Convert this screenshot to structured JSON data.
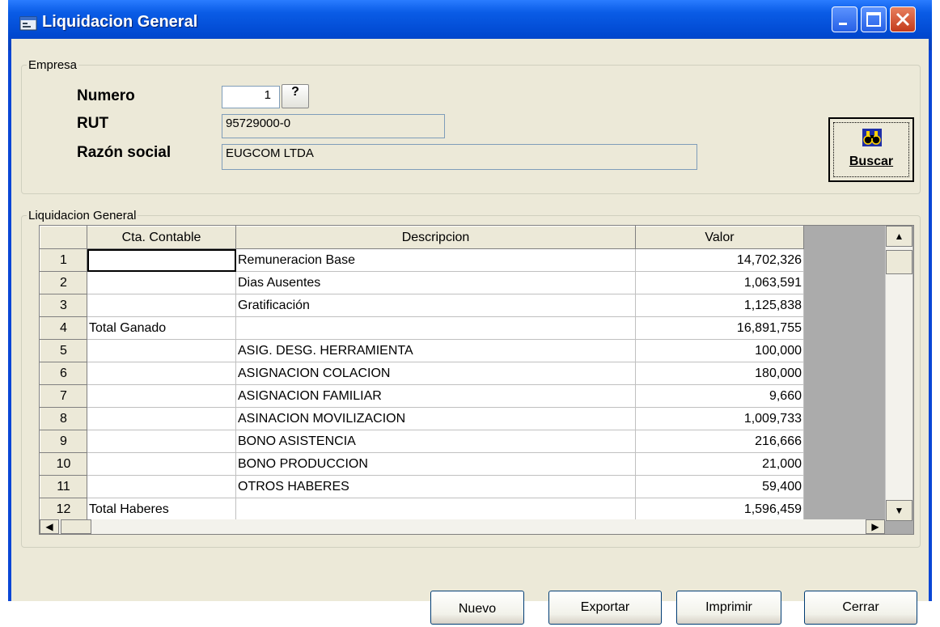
{
  "window": {
    "title": "Liquidacion General"
  },
  "empresa": {
    "legend": "Empresa",
    "numero_label": "Numero",
    "numero_value": "1",
    "lookup_button": "?",
    "rut_label": "RUT",
    "rut_value": "95729000-0",
    "razon_label": "Razón social",
    "razon_value": "EUGCOM LTDA",
    "buscar_button": "Buscar"
  },
  "grid": {
    "legend": "Liquidacion General",
    "columns": [
      "Cta. Contable",
      "Descripcion",
      "Valor"
    ],
    "rows": [
      {
        "n": "1",
        "cta": "",
        "desc": "Remuneracion Base",
        "valor": "14,702,326"
      },
      {
        "n": "2",
        "cta": "",
        "desc": "Dias Ausentes",
        "valor": "1,063,591"
      },
      {
        "n": "3",
        "cta": "",
        "desc": "Gratificación",
        "valor": "1,125,838"
      },
      {
        "n": "4",
        "cta": "Total Ganado",
        "desc": "",
        "valor": "16,891,755"
      },
      {
        "n": "5",
        "cta": "",
        "desc": "ASIG. DESG. HERRAMIENTA",
        "valor": "100,000"
      },
      {
        "n": "6",
        "cta": "",
        "desc": "ASIGNACION COLACION",
        "valor": "180,000"
      },
      {
        "n": "7",
        "cta": "",
        "desc": "ASIGNACION FAMILIAR",
        "valor": "9,660"
      },
      {
        "n": "8",
        "cta": "",
        "desc": "ASINACION MOVILIZACION",
        "valor": "1,009,733"
      },
      {
        "n": "9",
        "cta": "",
        "desc": "BONO ASISTENCIA",
        "valor": "216,666"
      },
      {
        "n": "10",
        "cta": "",
        "desc": "BONO PRODUCCION",
        "valor": "21,000"
      },
      {
        "n": "11",
        "cta": "",
        "desc": "OTROS HABERES",
        "valor": "59,400"
      },
      {
        "n": "12",
        "cta": "Total Haberes",
        "desc": "",
        "valor": "1,596,459"
      }
    ]
  },
  "buttons": {
    "nuevo": "Nuevo",
    "exportar": "Exportar",
    "imprimir": "Imprimir",
    "cerrar": "Cerrar"
  },
  "icons": {
    "app": "form-icon",
    "buscar": "binoculars-icon"
  }
}
